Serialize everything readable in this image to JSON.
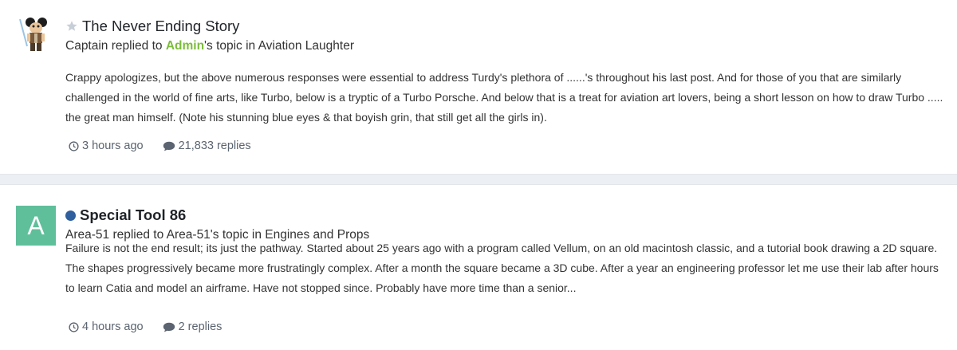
{
  "items": [
    {
      "title": "The Never Ending Story",
      "subtitle": {
        "author": "Captain",
        "replied_to": " replied to ",
        "target": "Admin",
        "suffix": "'s topic in Aviation Laughter"
      },
      "body": "Crappy apologizes, but the above numerous responses were essential to address Turdy's plethora of ......'s throughout his last post. And for those of you that are similarly challenged in the world of fine arts, like Turbo, below is a tryptic of a Turbo Porsche. And below that is a treat for aviation art lovers, being a short lesson on how to draw Turbo ..... the great man himself. (Note his stunning blue eyes & that boyish grin, that still get all the girls in).",
      "time": "3 hours ago",
      "replies": "21,833 replies"
    },
    {
      "title": "Special Tool 86",
      "avatar_letter": "A",
      "subtitle_text": "Area-51 replied to Area-51's topic in Engines and Props",
      "body": "Failure is not the end result; its just the pathway. Started about 25 years ago with a program called Vellum, on an old macintosh classic, and a tutorial book drawing a 2D square. The shapes progressively became more frustratingly complex. After a month the square became a 3D cube. After a year an engineering professor let me use their lab after hours to learn Catia and model an airframe. Have not stopped since. Probably have more time than a senior...",
      "time": "4 hours ago",
      "replies": "2 replies"
    }
  ],
  "colors": {
    "admin_link": "#7cbd3a",
    "unread_dot": "#2f5f9e",
    "avatar_bg": "#5fbf9b",
    "meta_text": "#5b6470"
  },
  "icons": [
    "star-icon",
    "unread-dot-icon",
    "clock-icon",
    "comment-icon"
  ]
}
